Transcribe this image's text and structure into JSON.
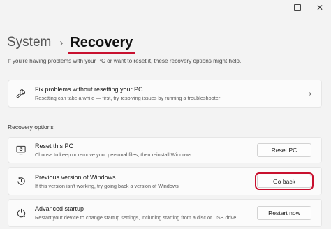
{
  "window": {
    "minimize_glyph": "",
    "maximize_glyph": "",
    "close_glyph": "✕"
  },
  "breadcrumb": {
    "parent": "System",
    "separator": "›",
    "current": "Recovery"
  },
  "intro_text": "If you're having problems with your PC or want to reset it, these recovery options might help.",
  "fix_card": {
    "title": "Fix problems without resetting your PC",
    "description": "Resetting can take a while — first, try resolving issues by running a troubleshooter",
    "icon": "wrench-icon",
    "chevron": "›"
  },
  "section_label": "Recovery options",
  "options": [
    {
      "title": "Reset this PC",
      "description": "Choose to keep or remove your personal files, then reinstall Windows",
      "button": "Reset PC",
      "icon": "reset-pc-icon"
    },
    {
      "title": "Previous version of Windows",
      "description": "If this version isn't working, try going back a version of Windows",
      "button": "Go back",
      "icon": "history-icon"
    },
    {
      "title": "Advanced startup",
      "description": "Restart your device to change startup settings, including starting from a disc or USB drive",
      "button": "Restart now",
      "icon": "advanced-startup-icon"
    }
  ],
  "colors": {
    "highlight": "#c8102e",
    "background": "#f3f3f3",
    "card": "#fbfbfb"
  }
}
